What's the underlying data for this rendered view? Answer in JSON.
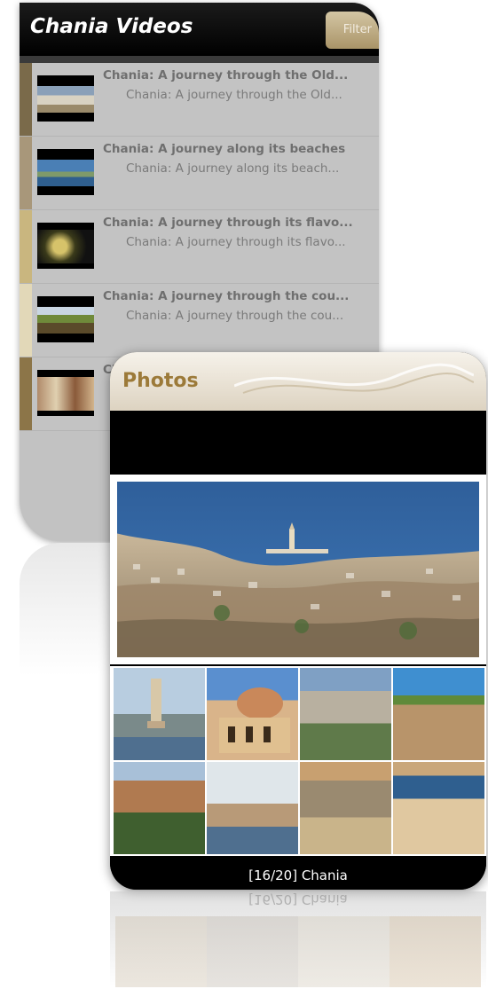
{
  "videos_screen": {
    "title": "Chania Videos",
    "filter_label": "Filter",
    "items": [
      {
        "title": "Chania: A journey through the Old...",
        "subtitle": "Chania: A journey through the Old...",
        "accent": "#7a6a4a"
      },
      {
        "title": "Chania: A journey along its beaches",
        "subtitle": "Chania: A journey along its beach...",
        "accent": "#a8977a"
      },
      {
        "title": "Chania: A journey through its flavo...",
        "subtitle": "Chania: A journey through its flavo...",
        "accent": "#c9b67f"
      },
      {
        "title": "Chania: A journey through the cou...",
        "subtitle": "Chania: A journey through the cou...",
        "accent": "#e2d8b8"
      },
      {
        "title": "Ch",
        "subtitle": "",
        "accent": "#8c7548"
      }
    ]
  },
  "photos_screen": {
    "title": "Photos",
    "caption": "[16/20] Chania"
  },
  "colors": {
    "brand_gold": "#9c7a39",
    "list_background": "#c2c2c2"
  }
}
